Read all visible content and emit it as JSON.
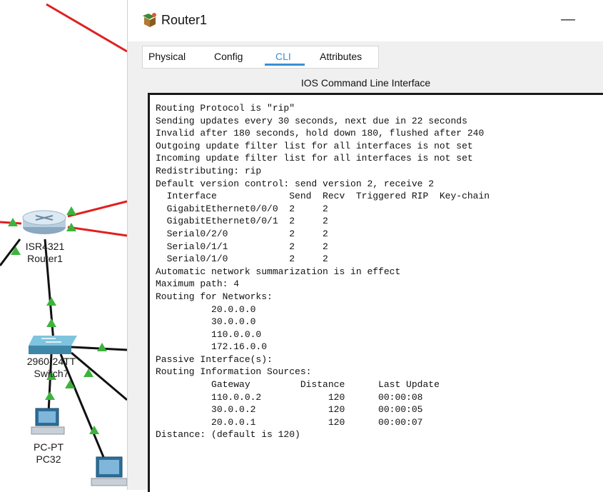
{
  "workspace": {
    "router": {
      "model": "ISR4321",
      "name": "Router1"
    },
    "switch": {
      "model": "2960-24TT",
      "name": "Switch7"
    },
    "pc": {
      "model": "PC-PT",
      "name": "PC32"
    },
    "link_colors": {
      "serial": "#e02020",
      "ethernet": "#111111",
      "status_up": "#3cb43c"
    }
  },
  "window": {
    "title": "Router1",
    "minimize_label": "—",
    "tabs": [
      {
        "label": "Physical"
      },
      {
        "label": "Config"
      },
      {
        "label": "CLI"
      },
      {
        "label": "Attributes"
      }
    ],
    "active_tab": "CLI",
    "accent_color": "#3a8fd6",
    "cli_header": "IOS Command Line Interface",
    "cli_lines": [
      "Routing Protocol is \"rip\"",
      "Sending updates every 30 seconds, next due in 22 seconds",
      "Invalid after 180 seconds, hold down 180, flushed after 240",
      "Outgoing update filter list for all interfaces is not set",
      "Incoming update filter list for all interfaces is not set",
      "Redistributing: rip",
      "Default version control: send version 2, receive 2",
      "  Interface             Send  Recv  Triggered RIP  Key-chain",
      "  GigabitEthernet0/0/0  2     2",
      "  GigabitEthernet0/0/1  2     2",
      "  Serial0/2/0           2     2",
      "  Serial0/1/1           2     2",
      "  Serial0/1/0           2     2",
      "Automatic network summarization is in effect",
      "Maximum path: 4",
      "Routing for Networks:",
      "          20.0.0.0",
      "          30.0.0.0",
      "          110.0.0.0",
      "          172.16.0.0",
      "Passive Interface(s):",
      "Routing Information Sources:",
      "          Gateway         Distance      Last Update",
      "          110.0.0.2            120      00:00:08",
      "          30.0.0.2             120      00:00:05",
      "          20.0.0.1             120      00:00:07",
      "Distance: (default is 120)"
    ]
  }
}
